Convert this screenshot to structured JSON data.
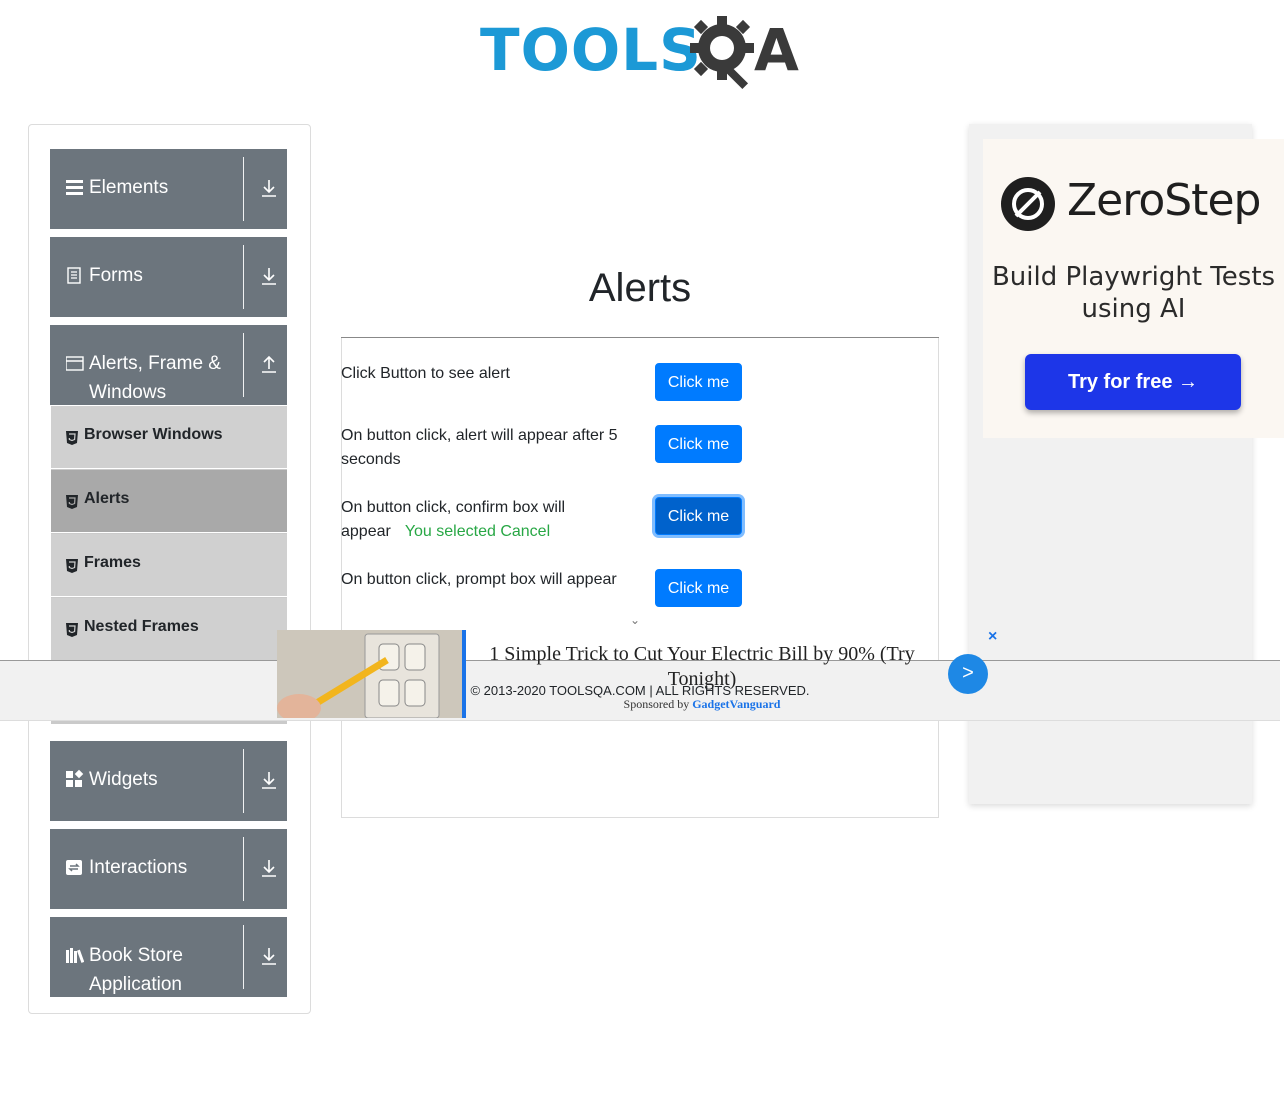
{
  "header": {
    "logo_text": "TOOLS",
    "logo_suffix": "A"
  },
  "sidebar": {
    "groups_top": [
      {
        "label": "Elements",
        "icon": "hamburger-icon",
        "arrow": "download-arrow-icon"
      },
      {
        "label": "Forms",
        "icon": "document-icon",
        "arrow": "download-arrow-icon"
      },
      {
        "label": "Alerts, Frame & Windows",
        "icon": "window-icon",
        "arrow": "upload-arrow-icon"
      }
    ],
    "menu_items": [
      {
        "label": "Browser Windows",
        "active": false
      },
      {
        "label": "Alerts",
        "active": true
      },
      {
        "label": "Frames",
        "active": false
      },
      {
        "label": "Nested Frames",
        "active": false
      }
    ],
    "groups_bottom": [
      {
        "label": "Widgets",
        "icon": "widgets-icon",
        "arrow": "download-arrow-icon"
      },
      {
        "label": "Interactions",
        "icon": "interactions-icon",
        "arrow": "download-arrow-icon"
      },
      {
        "label": "Book Store Application",
        "icon": "books-icon",
        "arrow": "download-arrow-icon"
      }
    ]
  },
  "main": {
    "title": "Alerts",
    "rows": [
      {
        "text": "Click Button to see alert",
        "button": "Click me"
      },
      {
        "text": "On button click, alert will appear after 5 seconds",
        "button": "Click me"
      },
      {
        "text": "On button click, confirm box will appear",
        "result": "You selected Cancel",
        "button": "Click me"
      },
      {
        "text": "On button click, prompt box will appear",
        "button": "Click me"
      }
    ]
  },
  "right_ad": {
    "brand": "ZeroStep",
    "tagline": "Build Playwright Tests using AI",
    "cta": "Try for free →"
  },
  "bottom_ad": {
    "headline": "1 Simple Trick to Cut Your Electric Bill by 90% (Try Tonight)",
    "next": ">",
    "close": "×",
    "sponsored_prefix": "Sponsored by",
    "sponsor": "GadgetVanguard"
  },
  "footer": {
    "copyright": "© 2013-2020 TOOLSQA.COM | ALL RIGHTS RESERVED."
  },
  "colors": {
    "primary": "#007bff",
    "sidebar_group": "#6c757d",
    "success": "#28a745",
    "logo_blue": "#1c99d6"
  }
}
